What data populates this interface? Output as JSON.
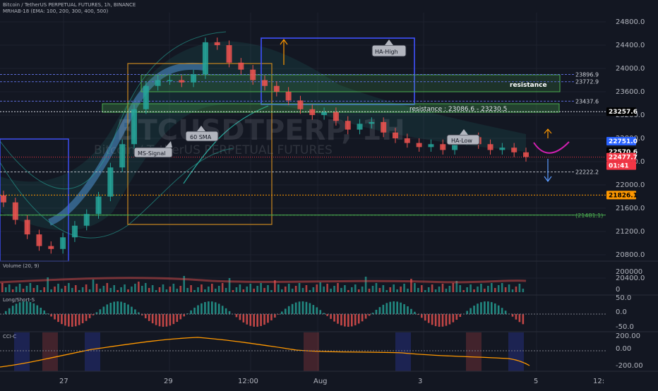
{
  "header": {
    "title": "Bitcoin / TetherUS PERPETUAL FUTURES, 1h, BINANCE",
    "indicator": "MRHAB-18 (EMA: 100, 200, 300, 400, 500)"
  },
  "watermark": {
    "symbol": "BTCUSDTPERP, 1H",
    "name": "Bitcoin / TetherUS PERPETUAL FUTURES"
  },
  "price_axis": {
    "ticks": [
      "24800.0",
      "24400.0",
      "24000.0",
      "23600.0",
      "23200.0",
      "22800.0",
      "22400.0",
      "22000.0",
      "21600.0",
      "21200.0",
      "20800.0",
      "20400.0"
    ],
    "tags": [
      {
        "text": "23257.6",
        "price": 23257.6,
        "bg": "#000000",
        "fg": "#ffffff"
      },
      {
        "text": "22751.0",
        "price": 22751.0,
        "bg": "#2962ff",
        "fg": "#ffffff"
      },
      {
        "text": "22570.6",
        "price": 22570.6,
        "bg": "#000000",
        "fg": "#ffffff"
      },
      {
        "text": "22477.7",
        "price": 22477.7,
        "bg": "#f23645",
        "fg": "#ffffff"
      },
      {
        "text": "01:41",
        "price": 22477.7,
        "bg": "#f23645",
        "fg": "#ffffff"
      },
      {
        "text": "21826.1",
        "price": 21826.1,
        "bg": "#ff9800",
        "fg": "#000000"
      }
    ]
  },
  "levels": [
    {
      "label": "23896.9",
      "price": 23896.9,
      "color": "#5b6bd5"
    },
    {
      "label": "23772.9",
      "price": 23772.9,
      "color": "#5b6bd5"
    },
    {
      "label": "23437.6",
      "price": 23437.6,
      "color": "#5b6bd5"
    },
    {
      "label": "22222.2",
      "price": 22222.2,
      "color": "#b2b5be"
    },
    {
      "label": "(21481.1)",
      "price": 21481.1,
      "color": "#4caf50"
    }
  ],
  "annotations": {
    "resistance_box": "resistance",
    "resistance_zone": "resistance : 23086.6 - 23230.5",
    "ha_high": "HA-High",
    "ha_low": "HA-Low",
    "sma60": "60 SMA",
    "ms_signal": "MS-Signal"
  },
  "panes": {
    "volume": {
      "title": "Volume (20, 9)",
      "ticks": [
        "200000",
        "0"
      ]
    },
    "longshort": {
      "title": "Long/Short-S",
      "ticks": [
        "50.0",
        "0.0",
        "-50.0"
      ]
    },
    "cci": {
      "title": "CCI-C",
      "ticks": [
        "200.00",
        "0.00",
        "-200.00"
      ]
    }
  },
  "time_axis": [
    "27",
    "29",
    "12:00",
    "Aug",
    "3",
    "5",
    "12:"
  ],
  "chart_data": {
    "type": "candlestick",
    "symbol": "BTCUSDT.P",
    "interval": "1h",
    "ylim": [
      20200,
      25000
    ],
    "last_price": 22477.7,
    "close": [
      21700,
      21400,
      21150,
      20950,
      20900,
      21100,
      21300,
      21500,
      21800,
      22300,
      22700,
      23300,
      23700,
      23800,
      23800,
      23760,
      23900,
      24450,
      24400,
      24100,
      23980,
      23800,
      23700,
      23600,
      23450,
      23300,
      23200,
      23250,
      23100,
      22950,
      23050,
      23080,
      22900,
      22800,
      22720,
      22650,
      22700,
      22600,
      22760,
      22820,
      22700,
      22600,
      22640,
      22560,
      22480
    ]
  },
  "colors": {
    "bg": "#131722",
    "grid": "#1e222d",
    "up": "#26a69a",
    "down": "#ef5350",
    "axis_text": "#b2b5be"
  }
}
